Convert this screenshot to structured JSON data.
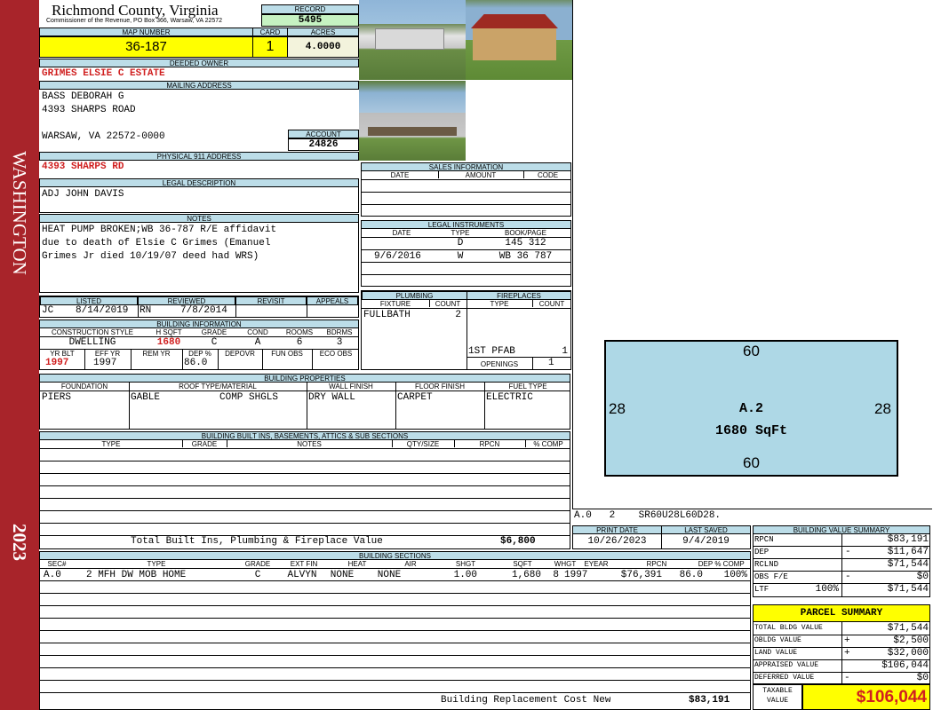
{
  "sidebar": {
    "district": "WASHINGTON",
    "year": "2023"
  },
  "county": {
    "title": "Richmond County, Virginia",
    "subtitle": "Commissioner of the Revenue, PO Box 366, Warsaw, VA 22572"
  },
  "record": {
    "label": "RECORD",
    "value": "5495"
  },
  "map_number": {
    "label": "MAP NUMBER",
    "value": "36-187"
  },
  "card": {
    "label": "CARD",
    "value": "1"
  },
  "acres": {
    "label": "ACRES",
    "value": "4.0000"
  },
  "owner": {
    "label": "DEEDED OWNER",
    "value": "GRIMES ELSIE C ESTATE"
  },
  "mailing": {
    "label": "MAILING ADDRESS",
    "line1": "BASS DEBORAH G",
    "line2": "4393 SHARPS ROAD",
    "line3": "WARSAW, VA 22572-0000"
  },
  "account": {
    "label": "ACCOUNT",
    "value": "24826"
  },
  "physical": {
    "label": "PHYSICAL 911 ADDRESS",
    "value": "4393 SHARPS RD"
  },
  "legal": {
    "label": "LEGAL DESCRIPTION",
    "value": "ADJ JOHN DAVIS"
  },
  "notes": {
    "label": "NOTES",
    "line1": "HEAT PUMP BROKEN;WB 36-787 R/E affidavit",
    "line2": "due to death of Elsie C Grimes (Emanuel",
    "line3": "Grimes Jr died 10/19/07 deed had WRS)"
  },
  "listing": {
    "headers": {
      "listed": "LISTED",
      "reviewed": "REVIEWED",
      "revisit": "REVISIT",
      "appeals": "APPEALS"
    },
    "listed_by": "JC",
    "listed_date": "8/14/2019",
    "reviewed_by": "RN",
    "reviewed_date": "7/8/2014"
  },
  "building_info": {
    "label": "BUILDING INFORMATION",
    "headers": [
      "CONSTRUCTION STYLE",
      "H SQFT",
      "GRADE",
      "COND",
      "ROOMS",
      "BDRMS"
    ],
    "values": [
      "DWELLING",
      "1680",
      "C",
      "A",
      "6",
      "3"
    ],
    "headers2": [
      "YR BLT",
      "EFF YR",
      "REM YR",
      "DEP %",
      "DEPOVR",
      "FUN OBS",
      "ECO OBS"
    ],
    "values2": [
      "1997",
      "1997",
      "",
      "86.0",
      "",
      "",
      ""
    ]
  },
  "sales": {
    "label": "SALES INFORMATION",
    "headers": [
      "DATE",
      "AMOUNT",
      "CODE"
    ]
  },
  "instruments": {
    "label": "LEGAL INSTRUMENTS",
    "headers": [
      "DATE",
      "TYPE",
      "BOOK/PAGE"
    ],
    "rows": [
      {
        "date": "",
        "type": "D",
        "book": "145 312"
      },
      {
        "date": "9/6/2016",
        "type": "W",
        "book": "WB 36 787"
      }
    ]
  },
  "plumbing": {
    "label": "PLUMBING",
    "headers": [
      "FIXTURE",
      "COUNT"
    ],
    "fixture": "FULLBATH",
    "count": "2"
  },
  "fireplaces": {
    "label": "FIREPLACES",
    "headers": [
      "TYPE",
      "COUNT"
    ],
    "type": "1ST PFAB",
    "count": "1",
    "openings_label": "OPENINGS",
    "openings": "1"
  },
  "properties": {
    "label": "BUILDING PROPERTIES",
    "headers": [
      "FOUNDATION",
      "ROOF TYPE/MATERIAL",
      "WALL FINISH",
      "FLOOR FINISH",
      "FUEL TYPE"
    ],
    "foundation": "PIERS",
    "roof_type": "GABLE",
    "roof_material": "COMP SHGLS",
    "wall": "DRY WALL",
    "floor": "CARPET",
    "fuel": "ELECTRIC"
  },
  "builtins": {
    "label": "BUILDING BUILT INS, BASEMENTS, ATTICS & SUB SECTIONS",
    "headers": [
      "TYPE",
      "GRADE",
      "NOTES",
      "QTY/SIZE",
      "RPCN",
      "% COMP"
    ],
    "total_label": "Total Built Ins, Plumbing & Fireplace Value",
    "total_value": "$6,800"
  },
  "sketch": {
    "top": "60",
    "bottom": "60",
    "left": "28",
    "right": "28",
    "code": "A.2",
    "area": "1680 SqFt",
    "footer": "A.0   2    SR60U28L60D28."
  },
  "dates": {
    "print_label": "PRINT DATE",
    "print_value": "10/26/2023",
    "saved_label": "LAST SAVED",
    "saved_value": "9/4/2019"
  },
  "sections": {
    "label": "BUILDING SECTIONS",
    "headers": [
      "SEC#",
      "TYPE",
      "GRADE",
      "EXT FIN",
      "HEAT",
      "AIR",
      "SHGT",
      "SQFT",
      "WHGT",
      "EYEAR",
      "RPCN",
      "DEP",
      "% COMP"
    ],
    "row": {
      "sec": "A.0",
      "type": "2 MFH DW MOB HOME",
      "grade": "C",
      "ext": "ALVYN",
      "heat": "NONE",
      "air": "NONE",
      "shgt": "1.00",
      "sqft": "1,680",
      "whgt": "8",
      "eyear": "1997",
      "rpcn": "$76,391",
      "dep": "86.0",
      "comp": "100%"
    },
    "rcn_label": "Building Replacement Cost New",
    "rcn_value": "$83,191"
  },
  "value_summary": {
    "label": "BUILDING VALUE SUMMARY",
    "rows": [
      {
        "k": "RPCN",
        "op": "",
        "pct": "",
        "v": "$83,191"
      },
      {
        "k": "DEP",
        "op": "-",
        "pct": "",
        "v": "$11,647"
      },
      {
        "k": "RCLND",
        "op": "",
        "pct": "",
        "v": "$71,544"
      },
      {
        "k": "OBS F/E",
        "op": "-",
        "pct": "",
        "v": "$0"
      },
      {
        "k": "LTF",
        "op": "",
        "pct": "100%",
        "v": "$71,544"
      }
    ]
  },
  "parcel": {
    "label": "PARCEL SUMMARY",
    "rows": [
      {
        "k": "TOTAL BLDG VALUE",
        "op": "",
        "v": "$71,544"
      },
      {
        "k": "OBLDG VALUE",
        "op": "+",
        "v": "$2,500"
      },
      {
        "k": "LAND VALUE",
        "op": "+",
        "v": "$32,000"
      },
      {
        "k": "APPRAISED VALUE",
        "op": "",
        "v": "$106,044"
      },
      {
        "k": "DEFERRED VALUE",
        "op": "-",
        "v": "$0"
      }
    ],
    "taxable_label1": "TAXABLE",
    "taxable_label2": "VALUE",
    "taxable_value": "$106,044"
  }
}
